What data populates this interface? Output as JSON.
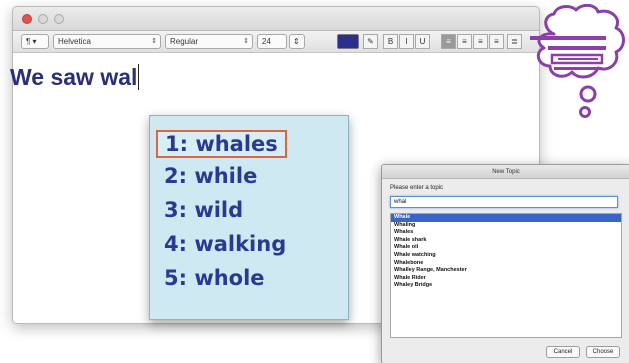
{
  "editor": {
    "toolbar": {
      "style_label": "¶ ▾",
      "font_family": "Helvetica",
      "font_typeface": "Regular",
      "font_size": "24",
      "bold": "B",
      "italic": "I",
      "underline": "U",
      "text_color": "#2c2f8c"
    },
    "document_text": "We saw wal"
  },
  "suggestions": [
    "1: whales",
    "2: while",
    "3: wild",
    "4: walking",
    "5: whole"
  ],
  "dialog": {
    "title": "New Topic",
    "prompt": "Please enter a topic",
    "input_value": "whal",
    "items": [
      "Whale",
      "Whaling",
      "Whales",
      "Whale shark",
      "Whale oil",
      "Whale watching",
      "Whalebone",
      "Whalley Range, Manchester",
      "Whale Rider",
      "Whaley Bridge"
    ],
    "cancel_label": "Cancel",
    "choose_label": "Choose"
  },
  "colors": {
    "accent": "#8b3fa8",
    "suggest_bg": "#cfe9f3",
    "suggest_text": "#2b3a8f",
    "highlight_border": "#d9673f",
    "selection_blue": "#3a64c8"
  },
  "icons": {
    "thought_bubble": "thought-bubble-icon"
  }
}
